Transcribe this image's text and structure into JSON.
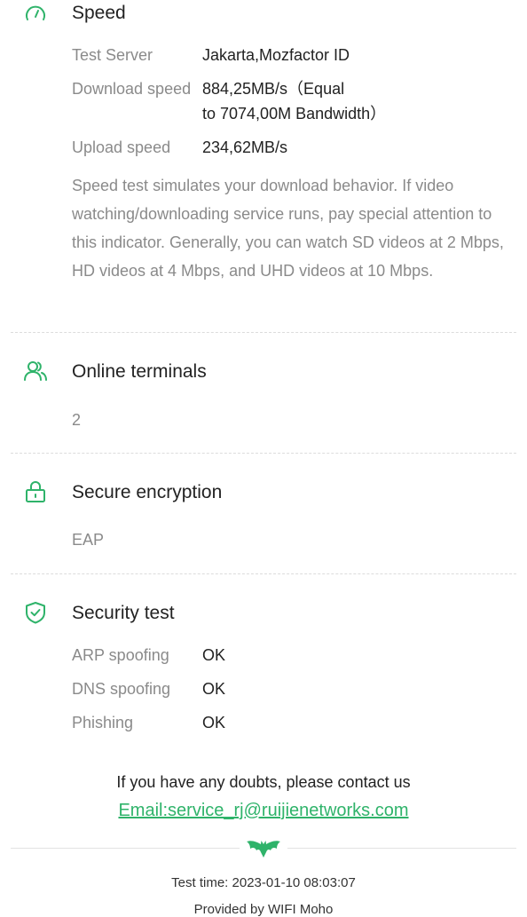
{
  "speed": {
    "title": "Speed",
    "test_server_label": "Test Server",
    "test_server_value": "Jakarta,Mozfactor ID",
    "download_label": "Download speed",
    "download_value_line1": "884,25MB/s（Equal",
    "download_value_line2": "to 7074,00M Bandwidth）",
    "upload_label": "Upload speed",
    "upload_value": "234,62MB/s",
    "description": "Speed test simulates your download behavior. If video watching/downloading service runs, pay special attention to this indicator. Generally, you can watch SD videos at 2 Mbps, HD videos at 4 Mbps, and UHD videos at 10 Mbps."
  },
  "terminals": {
    "title": "Online terminals",
    "value": "2"
  },
  "encryption": {
    "title": "Secure encryption",
    "value": "EAP"
  },
  "security": {
    "title": "Security test",
    "items": [
      {
        "label": "ARP spoofing",
        "value": "OK"
      },
      {
        "label": "DNS spoofing",
        "value": "OK"
      },
      {
        "label": "Phishing",
        "value": "OK"
      }
    ]
  },
  "footer": {
    "contact_text": "If you have any doubts, please contact us",
    "email_text": "Email:service_rj@ruijienetworks.com",
    "test_time": "Test time: 2023-01-10 08:03:07",
    "provided_by": "Provided by WIFI Moho"
  },
  "colors": {
    "accent": "#2fb36a",
    "label": "#8a8a8a",
    "text": "#222222"
  }
}
